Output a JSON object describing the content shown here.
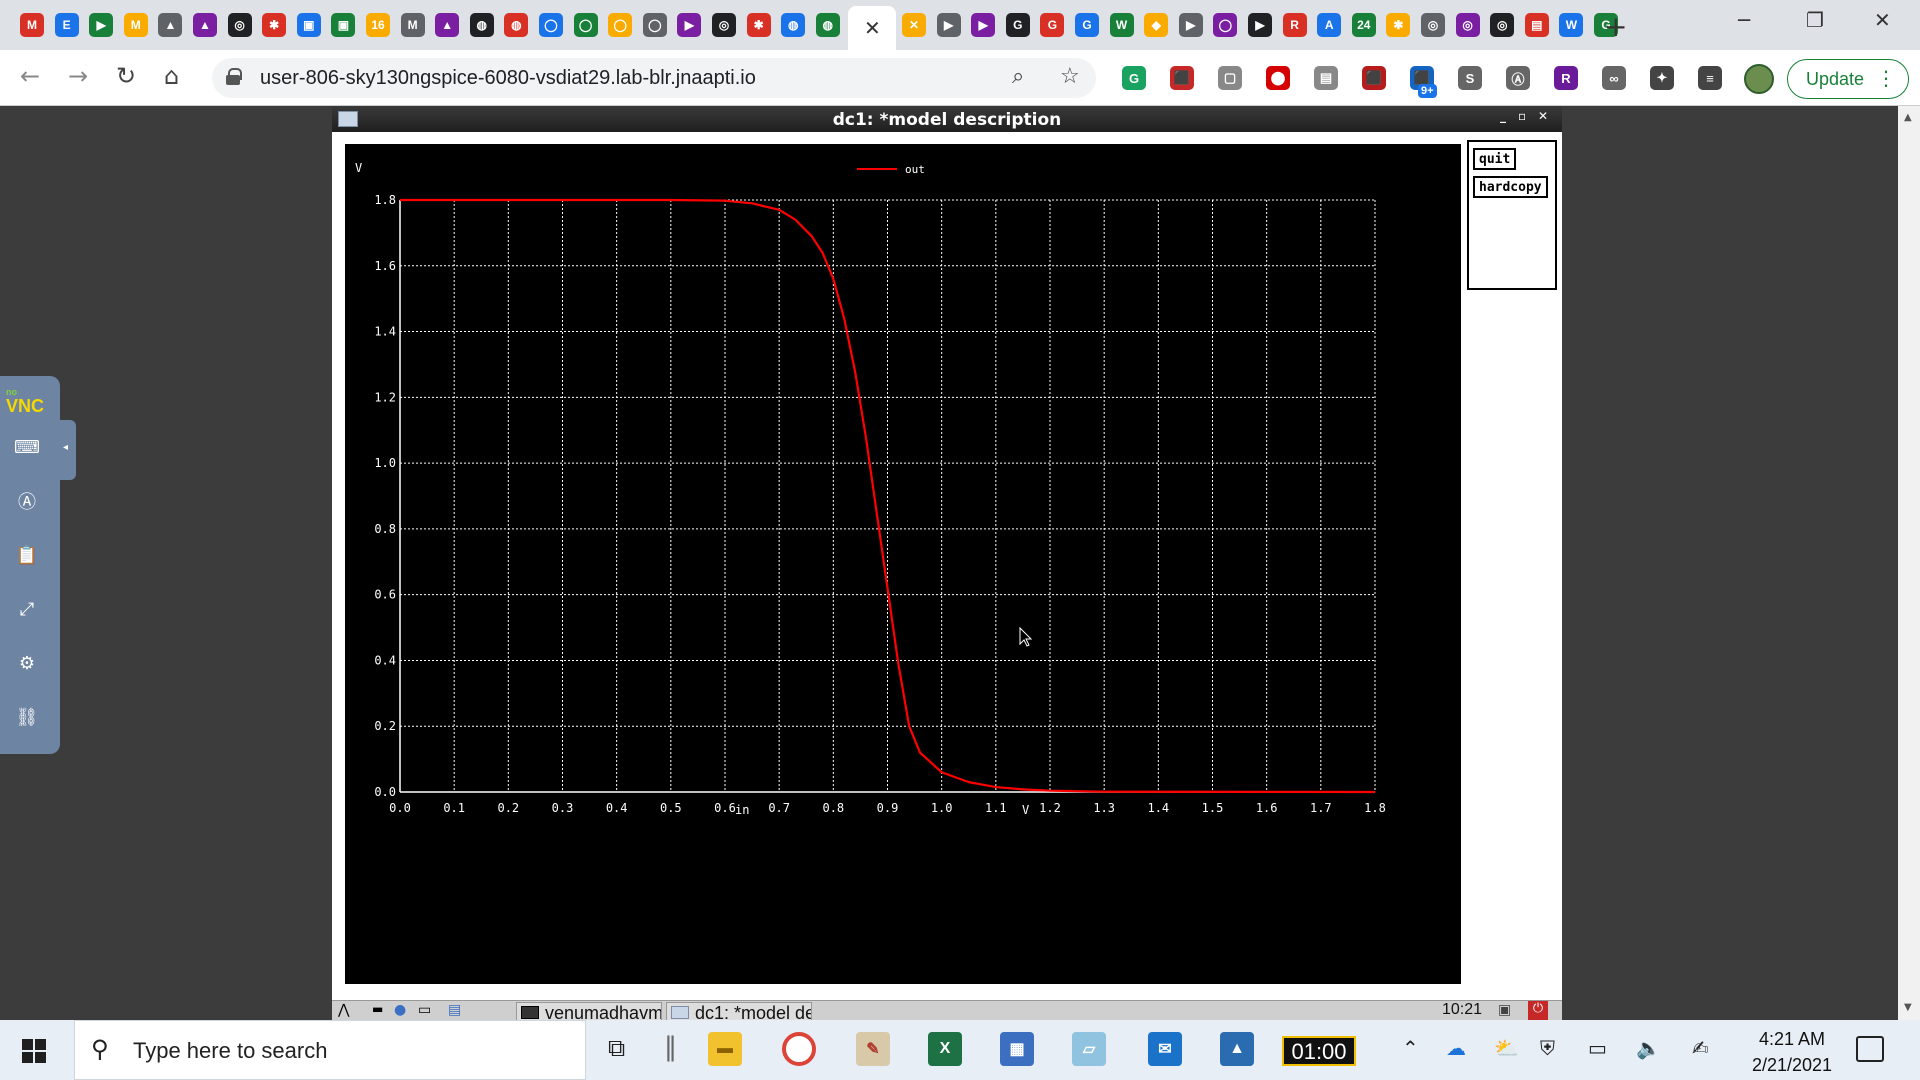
{
  "browser": {
    "url": "user-806-sky130ngspice-6080-vsdiat29.lab-blr.jnaapti.io",
    "update_label": "Update",
    "extension_badge": "9+",
    "tab_icons": [
      "M",
      "E",
      "▶",
      "M",
      "▲",
      "▲",
      "◎",
      "✱",
      "▣",
      "▣",
      "16",
      "M",
      "▲",
      "◍",
      "◍",
      "◯",
      "◯",
      "◯",
      "◯",
      "▶",
      "◎",
      "✱",
      "◍",
      "◍",
      "✕",
      "▶",
      "▶",
      "G",
      "G",
      "G",
      "W",
      "◆",
      "▶",
      "◯",
      "▶",
      "R",
      "A",
      "24",
      "✱",
      "◎",
      "◎",
      "◎",
      "▤",
      "W",
      "G"
    ],
    "ext_icons": [
      "G",
      "⬛",
      "▢",
      "⬤",
      "▤",
      "⬛",
      "⬛",
      "S",
      "Ⓐ",
      "R",
      "∞",
      "✦",
      "≡"
    ]
  },
  "ngspice": {
    "window_title": "dc1: *model description",
    "buttons": {
      "quit": "quit",
      "hardcopy": "hardcopy"
    }
  },
  "chart_data": {
    "type": "line",
    "title": "",
    "xlabel": "in",
    "x_unit": "V",
    "y_unit": "V",
    "xlim": [
      0.0,
      1.8
    ],
    "ylim": [
      0.0,
      1.8
    ],
    "x_ticks": [
      "0.0",
      "0.1",
      "0.2",
      "0.3",
      "0.4",
      "0.5",
      "0.6",
      "0.7",
      "0.8",
      "0.9",
      "1.0",
      "1.1",
      "1.2",
      "1.3",
      "1.4",
      "1.5",
      "1.6",
      "1.7",
      "1.8"
    ],
    "y_ticks": [
      "0.0",
      "0.2",
      "0.4",
      "0.6",
      "0.8",
      "1.0",
      "1.2",
      "1.4",
      "1.6",
      "1.8"
    ],
    "grid": true,
    "legend_position": "top-center",
    "background": "#000000",
    "series": [
      {
        "name": "out",
        "color": "#ff0000",
        "x": [
          0.0,
          0.5,
          0.6,
          0.65,
          0.7,
          0.73,
          0.76,
          0.78,
          0.8,
          0.82,
          0.84,
          0.86,
          0.88,
          0.9,
          0.92,
          0.94,
          0.96,
          1.0,
          1.05,
          1.1,
          1.15,
          1.2,
          1.3,
          1.8
        ],
        "y": [
          1.8,
          1.8,
          1.798,
          1.79,
          1.77,
          1.74,
          1.69,
          1.64,
          1.56,
          1.44,
          1.28,
          1.08,
          0.85,
          0.62,
          0.39,
          0.2,
          0.12,
          0.06,
          0.03,
          0.015,
          0.008,
          0.004,
          0.001,
          0.0
        ]
      }
    ]
  },
  "vnc_panel": {
    "logo_top": "no",
    "logo": "VNC"
  },
  "vnc_taskbar": {
    "items": [
      "venumadhavm...",
      "dc1: *model de..."
    ],
    "time": "10:21"
  },
  "windows_taskbar": {
    "search_placeholder": "Type here to search",
    "timer": "01:00",
    "time": "4:21 AM",
    "date": "2/21/2021"
  }
}
